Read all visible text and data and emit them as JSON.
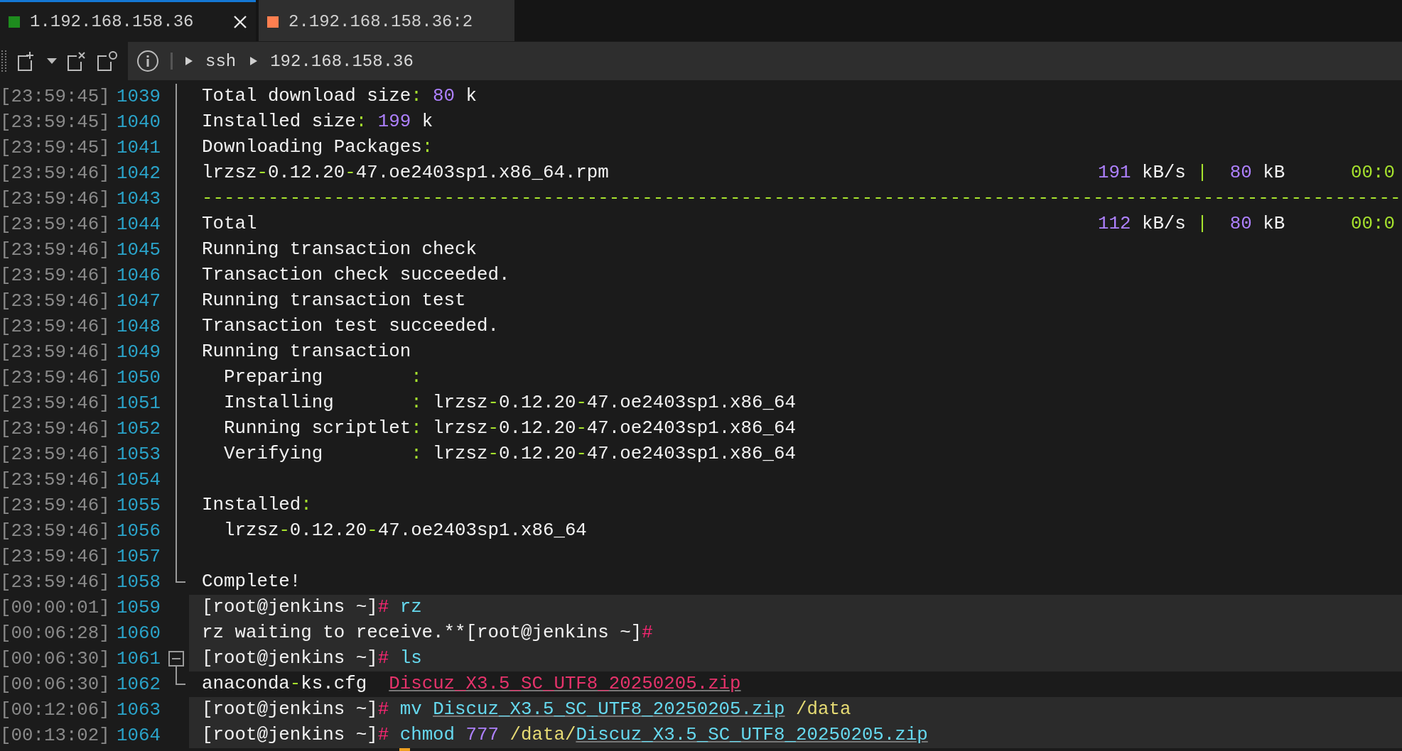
{
  "tabs": [
    {
      "label": "1.192.168.158.36",
      "selected": true,
      "color": "#1e8c1e"
    },
    {
      "label": "2.192.168.158.36:2",
      "selected": false,
      "color": "#ff7f50"
    }
  ],
  "address_bar": {
    "path": [
      "ssh",
      "192.168.158.36"
    ]
  },
  "terminal": {
    "cursor_visible": true,
    "lines": [
      {
        "time": "[23:59:45]",
        "number": "1039",
        "kind": "fold_body",
        "highlighted": false,
        "text": [
          {
            "kind": "plain",
            "text": "Total download size"
          },
          {
            "kind": "punct",
            "text": ":"
          },
          {
            "kind": "number",
            "text": " 80"
          },
          {
            "kind": "plain",
            "text": " k"
          }
        ]
      },
      {
        "time": "[23:59:45]",
        "number": "1040",
        "kind": "fold_body",
        "highlighted": false,
        "text": [
          {
            "kind": "plain",
            "text": "Installed size"
          },
          {
            "kind": "punct",
            "text": ":"
          },
          {
            "kind": "number",
            "text": " 199"
          },
          {
            "kind": "plain",
            "text": " k"
          }
        ]
      },
      {
        "time": "[23:59:45]",
        "number": "1041",
        "kind": "fold_body",
        "highlighted": false,
        "text": [
          {
            "kind": "plain",
            "text": "Downloading Packages"
          },
          {
            "kind": "punct",
            "text": ":"
          }
        ]
      },
      {
        "time": "[23:59:46]",
        "number": "1042",
        "kind": "fold_body",
        "highlighted": false,
        "text": [
          {
            "kind": "plain",
            "text": "lrzsz"
          },
          {
            "kind": "punct",
            "text": "-"
          },
          {
            "kind": "plain",
            "text": "0.12.20"
          },
          {
            "kind": "punct",
            "text": "-"
          },
          {
            "kind": "plain",
            "text": "47.oe2403sp1.x86_64.rpm"
          }
        ],
        "right": [
          {
            "kind": "number",
            "text": "191"
          },
          {
            "kind": "plain",
            "text": " kB/s "
          },
          {
            "kind": "punct",
            "text": "|"
          },
          {
            "kind": "number",
            "text": "  80"
          },
          {
            "kind": "plain",
            "text": " kB      "
          },
          {
            "kind": "punct",
            "text": "00:0"
          }
        ]
      },
      {
        "time": "[23:59:46]",
        "number": "1043",
        "kind": "fold_body",
        "highlighted": false,
        "text": [
          {
            "kind": "punct",
            "text": "-------------------------------------------------------------------------------------------------------------"
          }
        ]
      },
      {
        "time": "[23:59:46]",
        "number": "1044",
        "kind": "fold_body",
        "highlighted": false,
        "text": [
          {
            "kind": "plain",
            "text": "Total"
          }
        ],
        "right": [
          {
            "kind": "number",
            "text": "112"
          },
          {
            "kind": "plain",
            "text": " kB/s "
          },
          {
            "kind": "punct",
            "text": "|"
          },
          {
            "kind": "number",
            "text": "  80"
          },
          {
            "kind": "plain",
            "text": " kB      "
          },
          {
            "kind": "punct",
            "text": "00:0"
          }
        ]
      },
      {
        "time": "[23:59:46]",
        "number": "1045",
        "kind": "fold_body",
        "highlighted": false,
        "text": [
          {
            "kind": "plain",
            "text": "Running transaction check"
          }
        ]
      },
      {
        "time": "[23:59:46]",
        "number": "1046",
        "kind": "fold_body",
        "highlighted": false,
        "text": [
          {
            "kind": "plain",
            "text": "Transaction check succeeded."
          }
        ]
      },
      {
        "time": "[23:59:46]",
        "number": "1047",
        "kind": "fold_body",
        "highlighted": false,
        "text": [
          {
            "kind": "plain",
            "text": "Running transaction test"
          }
        ]
      },
      {
        "time": "[23:59:46]",
        "number": "1048",
        "kind": "fold_body",
        "highlighted": false,
        "text": [
          {
            "kind": "plain",
            "text": "Transaction test succeeded."
          }
        ]
      },
      {
        "time": "[23:59:46]",
        "number": "1049",
        "kind": "fold_body",
        "highlighted": false,
        "text": [
          {
            "kind": "plain",
            "text": "Running transaction"
          }
        ]
      },
      {
        "time": "[23:59:46]",
        "number": "1050",
        "kind": "fold_body",
        "highlighted": false,
        "text": [
          {
            "kind": "plain",
            "text": "  Preparing        "
          },
          {
            "kind": "punct",
            "text": ":"
          }
        ]
      },
      {
        "time": "[23:59:46]",
        "number": "1051",
        "kind": "fold_body",
        "highlighted": false,
        "text": [
          {
            "kind": "plain",
            "text": "  Installing       "
          },
          {
            "kind": "punct",
            "text": ":"
          },
          {
            "kind": "plain",
            "text": " lrzsz"
          },
          {
            "kind": "punct",
            "text": "-"
          },
          {
            "kind": "plain",
            "text": "0.12.20"
          },
          {
            "kind": "punct",
            "text": "-"
          },
          {
            "kind": "plain",
            "text": "47.oe2403sp1.x86_64"
          }
        ]
      },
      {
        "time": "[23:59:46]",
        "number": "1052",
        "kind": "fold_body",
        "highlighted": false,
        "text": [
          {
            "kind": "plain",
            "text": "  Running scriptlet"
          },
          {
            "kind": "punct",
            "text": ":"
          },
          {
            "kind": "plain",
            "text": " lrzsz"
          },
          {
            "kind": "punct",
            "text": "-"
          },
          {
            "kind": "plain",
            "text": "0.12.20"
          },
          {
            "kind": "punct",
            "text": "-"
          },
          {
            "kind": "plain",
            "text": "47.oe2403sp1.x86_64"
          }
        ]
      },
      {
        "time": "[23:59:46]",
        "number": "1053",
        "kind": "fold_body",
        "highlighted": false,
        "text": [
          {
            "kind": "plain",
            "text": "  Verifying        "
          },
          {
            "kind": "punct",
            "text": ":"
          },
          {
            "kind": "plain",
            "text": " lrzsz"
          },
          {
            "kind": "punct",
            "text": "-"
          },
          {
            "kind": "plain",
            "text": "0.12.20"
          },
          {
            "kind": "punct",
            "text": "-"
          },
          {
            "kind": "plain",
            "text": "47.oe2403sp1.x86_64"
          }
        ]
      },
      {
        "time": "[23:59:46]",
        "number": "1054",
        "kind": "fold_body"
      },
      {
        "time": "[23:59:46]",
        "number": "1055",
        "kind": "fold_body",
        "highlighted": false,
        "text": [
          {
            "kind": "plain",
            "text": "Installed"
          },
          {
            "kind": "punct",
            "text": ":"
          }
        ]
      },
      {
        "time": "[23:59:46]",
        "number": "1056",
        "kind": "fold_body",
        "highlighted": false,
        "text": [
          {
            "kind": "plain",
            "text": "  lrzsz"
          },
          {
            "kind": "punct",
            "text": "-"
          },
          {
            "kind": "plain",
            "text": "0.12.20"
          },
          {
            "kind": "punct",
            "text": "-"
          },
          {
            "kind": "plain",
            "text": "47.oe2403sp1.x86_64"
          }
        ]
      },
      {
        "time": "[23:59:46]",
        "number": "1057",
        "kind": "fold_body"
      },
      {
        "time": "[23:59:46]",
        "number": "1058",
        "kind": "fold_end",
        "highlighted": false,
        "text": [
          {
            "kind": "plain",
            "text": "Complete!"
          }
        ]
      },
      {
        "time": "[00:00:01]",
        "number": "1059",
        "kind": "plain",
        "highlighted": true,
        "text": [
          {
            "kind": "plain",
            "text": "[root@jenkins ~]"
          },
          {
            "kind": "prompt",
            "text": "#"
          },
          {
            "kind": "command",
            "text": " rz"
          }
        ]
      },
      {
        "time": "[00:06:28]",
        "number": "1060",
        "kind": "plain",
        "highlighted": true,
        "text": [
          {
            "kind": "plain",
            "text": "rz waiting to receive.**[root@jenkins ~]"
          },
          {
            "kind": "prompt",
            "text": "#"
          }
        ]
      },
      {
        "time": "[00:06:30]",
        "number": "1061",
        "kind": "fold_start",
        "highlighted": true,
        "text": [
          {
            "kind": "plain",
            "text": "[root@jenkins ~]"
          },
          {
            "kind": "prompt",
            "text": "#"
          },
          {
            "kind": "command",
            "text": " ls"
          }
        ]
      },
      {
        "time": "[00:06:30]",
        "number": "1062",
        "kind": "fold_end",
        "highlighted": false,
        "text": [
          {
            "kind": "plain",
            "text": "anaconda"
          },
          {
            "kind": "punct",
            "text": "-"
          },
          {
            "kind": "plain",
            "text": "ks.cfg  "
          },
          {
            "kind": "archive_link",
            "text": "Discuz_X3.5_SC_UTF8_20250205.zip"
          }
        ]
      },
      {
        "time": "[00:12:06]",
        "number": "1063",
        "kind": "plain",
        "highlighted": true,
        "text": [
          {
            "kind": "plain",
            "text": "[root@jenkins ~]"
          },
          {
            "kind": "prompt",
            "text": "#"
          },
          {
            "kind": "command",
            "text": " mv "
          },
          {
            "kind": "file_link",
            "text": "Discuz_X3.5_SC_UTF8_20250205.zip"
          },
          {
            "kind": "path",
            "text": " /data"
          }
        ]
      },
      {
        "time": "[00:13:02]",
        "number": "1064",
        "kind": "plain",
        "highlighted": true,
        "text": [
          {
            "kind": "plain",
            "text": "[root@jenkins ~]"
          },
          {
            "kind": "prompt",
            "text": "#"
          },
          {
            "kind": "command",
            "text": " chmod"
          },
          {
            "kind": "number",
            "text": " 777"
          },
          {
            "kind": "path",
            "text": " /data/"
          },
          {
            "kind": "file_link",
            "text": "Discuz_X3.5_SC_UTF8_20250205.zip"
          }
        ]
      }
    ]
  }
}
